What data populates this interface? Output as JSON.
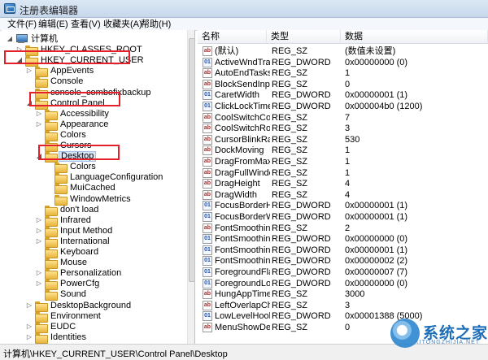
{
  "window": {
    "title": "注册表编辑器"
  },
  "menu": [
    "文件(F)",
    "编辑(E)",
    "查看(V)",
    "收藏夹(A)",
    "帮助(H)"
  ],
  "tree": [
    {
      "label": "计算机",
      "depth": 0,
      "exp": "open",
      "icon": "computer"
    },
    {
      "label": "HKEY_CLASSES_ROOT",
      "depth": 1,
      "exp": "closed",
      "icon": "folder"
    },
    {
      "label": "HKEY_CURRENT_USER",
      "depth": 1,
      "exp": "open",
      "icon": "folder"
    },
    {
      "label": "AppEvents",
      "depth": 2,
      "exp": "closed",
      "icon": "folder"
    },
    {
      "label": "Console",
      "depth": 2,
      "exp": "none",
      "icon": "folder"
    },
    {
      "label": "console_combofixbackup",
      "depth": 2,
      "exp": "none",
      "icon": "folder"
    },
    {
      "label": "Control Panel",
      "depth": 2,
      "exp": "open",
      "icon": "folder"
    },
    {
      "label": "Accessibility",
      "depth": 3,
      "exp": "closed",
      "icon": "folder"
    },
    {
      "label": "Appearance",
      "depth": 3,
      "exp": "closed",
      "icon": "folder"
    },
    {
      "label": "Colors",
      "depth": 3,
      "exp": "none",
      "icon": "folder"
    },
    {
      "label": "Cursors",
      "depth": 3,
      "exp": "none",
      "icon": "folder"
    },
    {
      "label": "Desktop",
      "depth": 3,
      "exp": "open",
      "icon": "folder",
      "selected": true
    },
    {
      "label": "Colors",
      "depth": 4,
      "exp": "none",
      "icon": "folder"
    },
    {
      "label": "LanguageConfiguration",
      "depth": 4,
      "exp": "none",
      "icon": "folder"
    },
    {
      "label": "MuiCached",
      "depth": 4,
      "exp": "none",
      "icon": "folder"
    },
    {
      "label": "WindowMetrics",
      "depth": 4,
      "exp": "none",
      "icon": "folder"
    },
    {
      "label": "don't load",
      "depth": 3,
      "exp": "none",
      "icon": "folder"
    },
    {
      "label": "Infrared",
      "depth": 3,
      "exp": "closed",
      "icon": "folder"
    },
    {
      "label": "Input Method",
      "depth": 3,
      "exp": "closed",
      "icon": "folder"
    },
    {
      "label": "International",
      "depth": 3,
      "exp": "closed",
      "icon": "folder"
    },
    {
      "label": "Keyboard",
      "depth": 3,
      "exp": "none",
      "icon": "folder"
    },
    {
      "label": "Mouse",
      "depth": 3,
      "exp": "none",
      "icon": "folder"
    },
    {
      "label": "Personalization",
      "depth": 3,
      "exp": "closed",
      "icon": "folder"
    },
    {
      "label": "PowerCfg",
      "depth": 3,
      "exp": "closed",
      "icon": "folder"
    },
    {
      "label": "Sound",
      "depth": 3,
      "exp": "none",
      "icon": "folder"
    },
    {
      "label": "DesktopBackground",
      "depth": 2,
      "exp": "closed",
      "icon": "folder"
    },
    {
      "label": "Environment",
      "depth": 2,
      "exp": "none",
      "icon": "folder"
    },
    {
      "label": "EUDC",
      "depth": 2,
      "exp": "closed",
      "icon": "folder"
    },
    {
      "label": "Identities",
      "depth": 2,
      "exp": "closed",
      "icon": "folder"
    }
  ],
  "list": {
    "columns": [
      "名称",
      "类型",
      "数据"
    ],
    "rows": [
      {
        "name": "(默认)",
        "type": "REG_SZ",
        "data": "(数值未设置)"
      },
      {
        "name": "ActiveWndTrack...",
        "type": "REG_DWORD",
        "data": "0x00000000 (0)"
      },
      {
        "name": "AutoEndTasks",
        "type": "REG_SZ",
        "data": "1"
      },
      {
        "name": "BlockSendInput...",
        "type": "REG_SZ",
        "data": "0"
      },
      {
        "name": "CaretWidth",
        "type": "REG_DWORD",
        "data": "0x00000001 (1)"
      },
      {
        "name": "ClickLockTime",
        "type": "REG_DWORD",
        "data": "0x000004b0 (1200)"
      },
      {
        "name": "CoolSwitchColu...",
        "type": "REG_SZ",
        "data": "7"
      },
      {
        "name": "CoolSwitchRows",
        "type": "REG_SZ",
        "data": "3"
      },
      {
        "name": "CursorBlinkRate",
        "type": "REG_SZ",
        "data": "530"
      },
      {
        "name": "DockMoving",
        "type": "REG_SZ",
        "data": "1"
      },
      {
        "name": "DragFromMaxi...",
        "type": "REG_SZ",
        "data": "1"
      },
      {
        "name": "DragFullWindows",
        "type": "REG_SZ",
        "data": "1"
      },
      {
        "name": "DragHeight",
        "type": "REG_SZ",
        "data": "4"
      },
      {
        "name": "DragWidth",
        "type": "REG_SZ",
        "data": "4"
      },
      {
        "name": "FocusBorderHei...",
        "type": "REG_DWORD",
        "data": "0x00000001 (1)"
      },
      {
        "name": "FocusBorderWid...",
        "type": "REG_DWORD",
        "data": "0x00000001 (1)"
      },
      {
        "name": "FontSmoothing",
        "type": "REG_SZ",
        "data": "2"
      },
      {
        "name": "FontSmoothing...",
        "type": "REG_DWORD",
        "data": "0x00000000 (0)"
      },
      {
        "name": "FontSmoothing...",
        "type": "REG_DWORD",
        "data": "0x00000001 (1)"
      },
      {
        "name": "FontSmoothing...",
        "type": "REG_DWORD",
        "data": "0x00000002 (2)"
      },
      {
        "name": "ForegroundFlas...",
        "type": "REG_DWORD",
        "data": "0x00000007 (7)"
      },
      {
        "name": "ForegroundLock...",
        "type": "REG_DWORD",
        "data": "0x00000000 (0)"
      },
      {
        "name": "HungAppTimeo...",
        "type": "REG_SZ",
        "data": "3000"
      },
      {
        "name": "LeftOverlapChars",
        "type": "REG_SZ",
        "data": "3"
      },
      {
        "name": "LowLevelHooks...",
        "type": "REG_DWORD",
        "data": "0x00001388 (5000)"
      },
      {
        "name": "MenuShowDela...",
        "type": "REG_SZ",
        "data": "0"
      }
    ]
  },
  "status": {
    "path": "计算机\\HKEY_CURRENT_USER\\Control Panel\\Desktop"
  },
  "watermark": {
    "text": "系统之家",
    "sub": "XITONGZHIJIA.NET"
  },
  "colors": {
    "highlight": "#e4212a",
    "selection": "#d8e6f7",
    "title_bar": "#c7d8ec"
  }
}
